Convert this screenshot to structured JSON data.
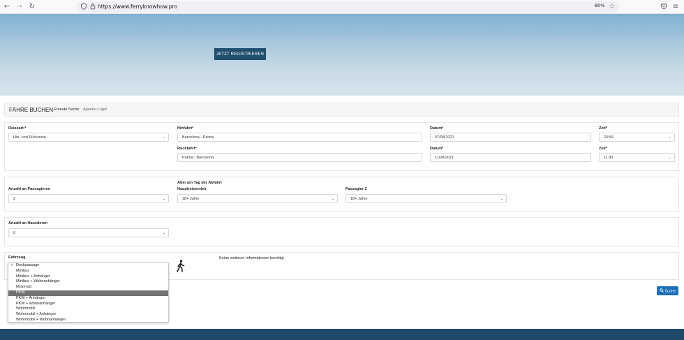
{
  "browser": {
    "url": "https://www.ferryknowhow.pro",
    "zoom": "80%"
  },
  "hero": {
    "register_label": "JETZT REGISTRIEREN"
  },
  "booking": {
    "title": "FÄHRE BUCHEN",
    "tab_new_search": "Erneute Suche",
    "tab_agency_login": "Agentur-Login"
  },
  "trip": {
    "type_label": "Reiseart:*",
    "type_value": "Hin- und Rückreise",
    "outbound_label": "Hinfahrt*",
    "outbound_value": "Barcelona - Palma",
    "outbound_date_label": "Datum*",
    "outbound_date_value": "07/08/2021",
    "outbound_time_label": "Zeit*",
    "outbound_time_value": "23:59",
    "return_label": "Rückfahrt*",
    "return_value": "Palma - Barcelona",
    "return_date_label": "Datum*",
    "return_date_value": "11/08/2021",
    "return_time_label": "Zeit*",
    "return_time_value": "11:30"
  },
  "passengers": {
    "count_label": "Anzahl an Passagieren",
    "count_value": "2",
    "age_heading": "Alter am Tag der Abfahrt",
    "main_traveler_label": "Hauptreisende/r",
    "main_traveler_value": "18+ Jahre",
    "passenger2_label": "Passagier 2",
    "passenger2_value": "18+ Jahre"
  },
  "pets": {
    "label": "Anzahl an Haustieren",
    "value": "0"
  },
  "vehicle": {
    "label": "Fahrzeug",
    "info_text": "Keine weiteren Informationen benötigt",
    "options": [
      "Deckpassage",
      "Minibus",
      "Minibus + Anhänger",
      "Minibus + Wohnanhänger",
      "Motorrad",
      "PKW",
      "PKW + Anhänger",
      "PKW + Wohnanhänger",
      "Wohnmobil",
      "Wohnmobil + Anhänger",
      "Wohnmobil + Wohnanhänger"
    ],
    "checked_option": "Deckpassage",
    "highlighted_option": "PKW"
  },
  "search_label": "Suche",
  "icons": {
    "back": "back-arrow-icon",
    "forward": "forward-arrow-icon",
    "reload": "reload-icon",
    "shield": "shield-icon",
    "lock": "lock-icon",
    "bookmark": "star-icon",
    "pocket": "pocket-icon",
    "menu": "hamburger-menu-icon",
    "pedestrian": "pedestrian-icon",
    "search": "search-icon"
  },
  "colors": {
    "hero_button": "#1f4f6e",
    "search_button": "#1e6fb8",
    "footer": "#1f4a6b",
    "dropdown_highlight": "#737373"
  }
}
